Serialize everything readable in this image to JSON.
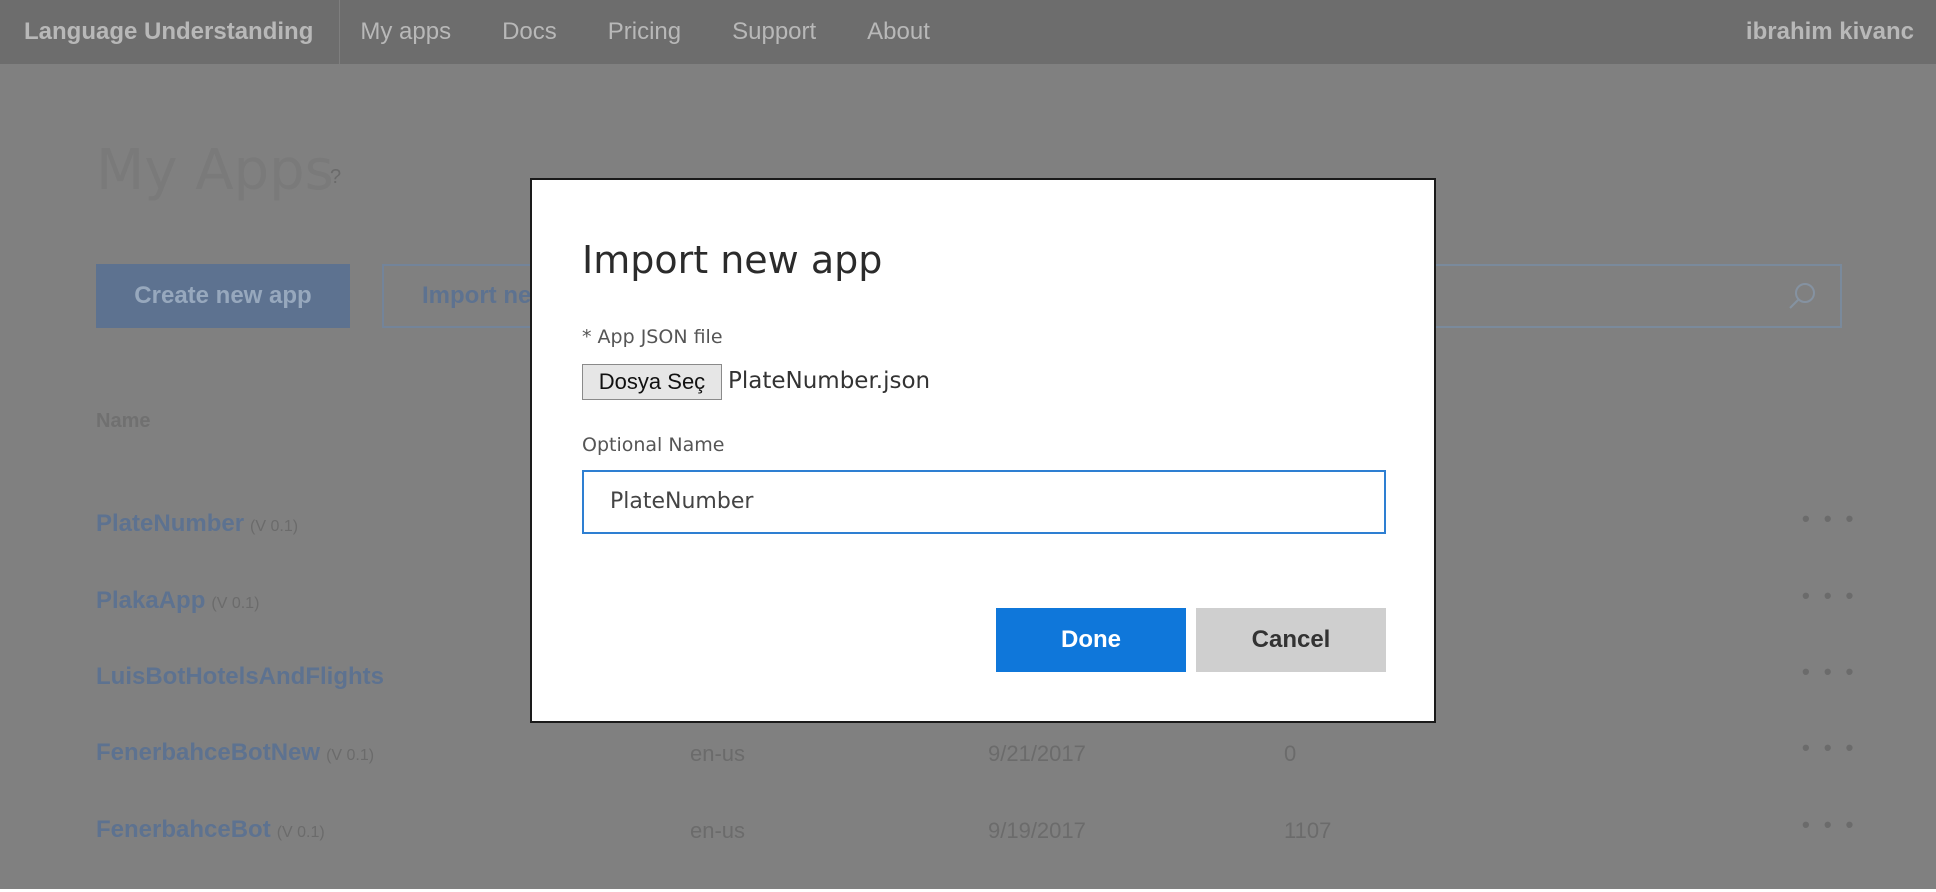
{
  "nav": {
    "brand": "Language Understanding",
    "links": [
      "My apps",
      "Docs",
      "Pricing",
      "Support",
      "About"
    ],
    "user": "ibrahim kivanc"
  },
  "page": {
    "title": "My Apps",
    "help": "?",
    "create_label": "Create new app",
    "import_label": "Import ne",
    "column_name": "Name"
  },
  "apps": [
    {
      "name": "PlateNumber",
      "version": "(V 0.1)",
      "culture": "",
      "date": "",
      "endpoint": ""
    },
    {
      "name": "PlakaApp",
      "version": "(V 0.1)",
      "culture": "",
      "date": "",
      "endpoint": ""
    },
    {
      "name": "LuisBotHotelsAndFlights",
      "version": "",
      "culture": "",
      "date": "",
      "endpoint": ""
    },
    {
      "name": "FenerbahceBotNew",
      "version": "(V 0.1)",
      "culture": "en-us",
      "date": "9/21/2017",
      "endpoint": "0"
    },
    {
      "name": "FenerbahceBot",
      "version": "(V 0.1)",
      "culture": "en-us",
      "date": "9/19/2017",
      "endpoint": "1107"
    }
  ],
  "more_label": "• • •",
  "dialog": {
    "title": "Import new app",
    "file_label": "* App JSON file",
    "file_button": "Dosya Seç",
    "file_name": "PlateNumber.json",
    "name_label": "Optional Name",
    "name_value": "PlateNumber",
    "done_label": "Done",
    "cancel_label": "Cancel"
  },
  "colors": {
    "nav_bg": "#6d6d6d",
    "page_bg": "#808080",
    "done_bg": "#0f77da",
    "cancel_bg": "#cfcfcf",
    "input_border": "#2e7fd2"
  },
  "icons": {
    "search": "search-icon",
    "help": "help-icon",
    "more": "more-icon"
  }
}
